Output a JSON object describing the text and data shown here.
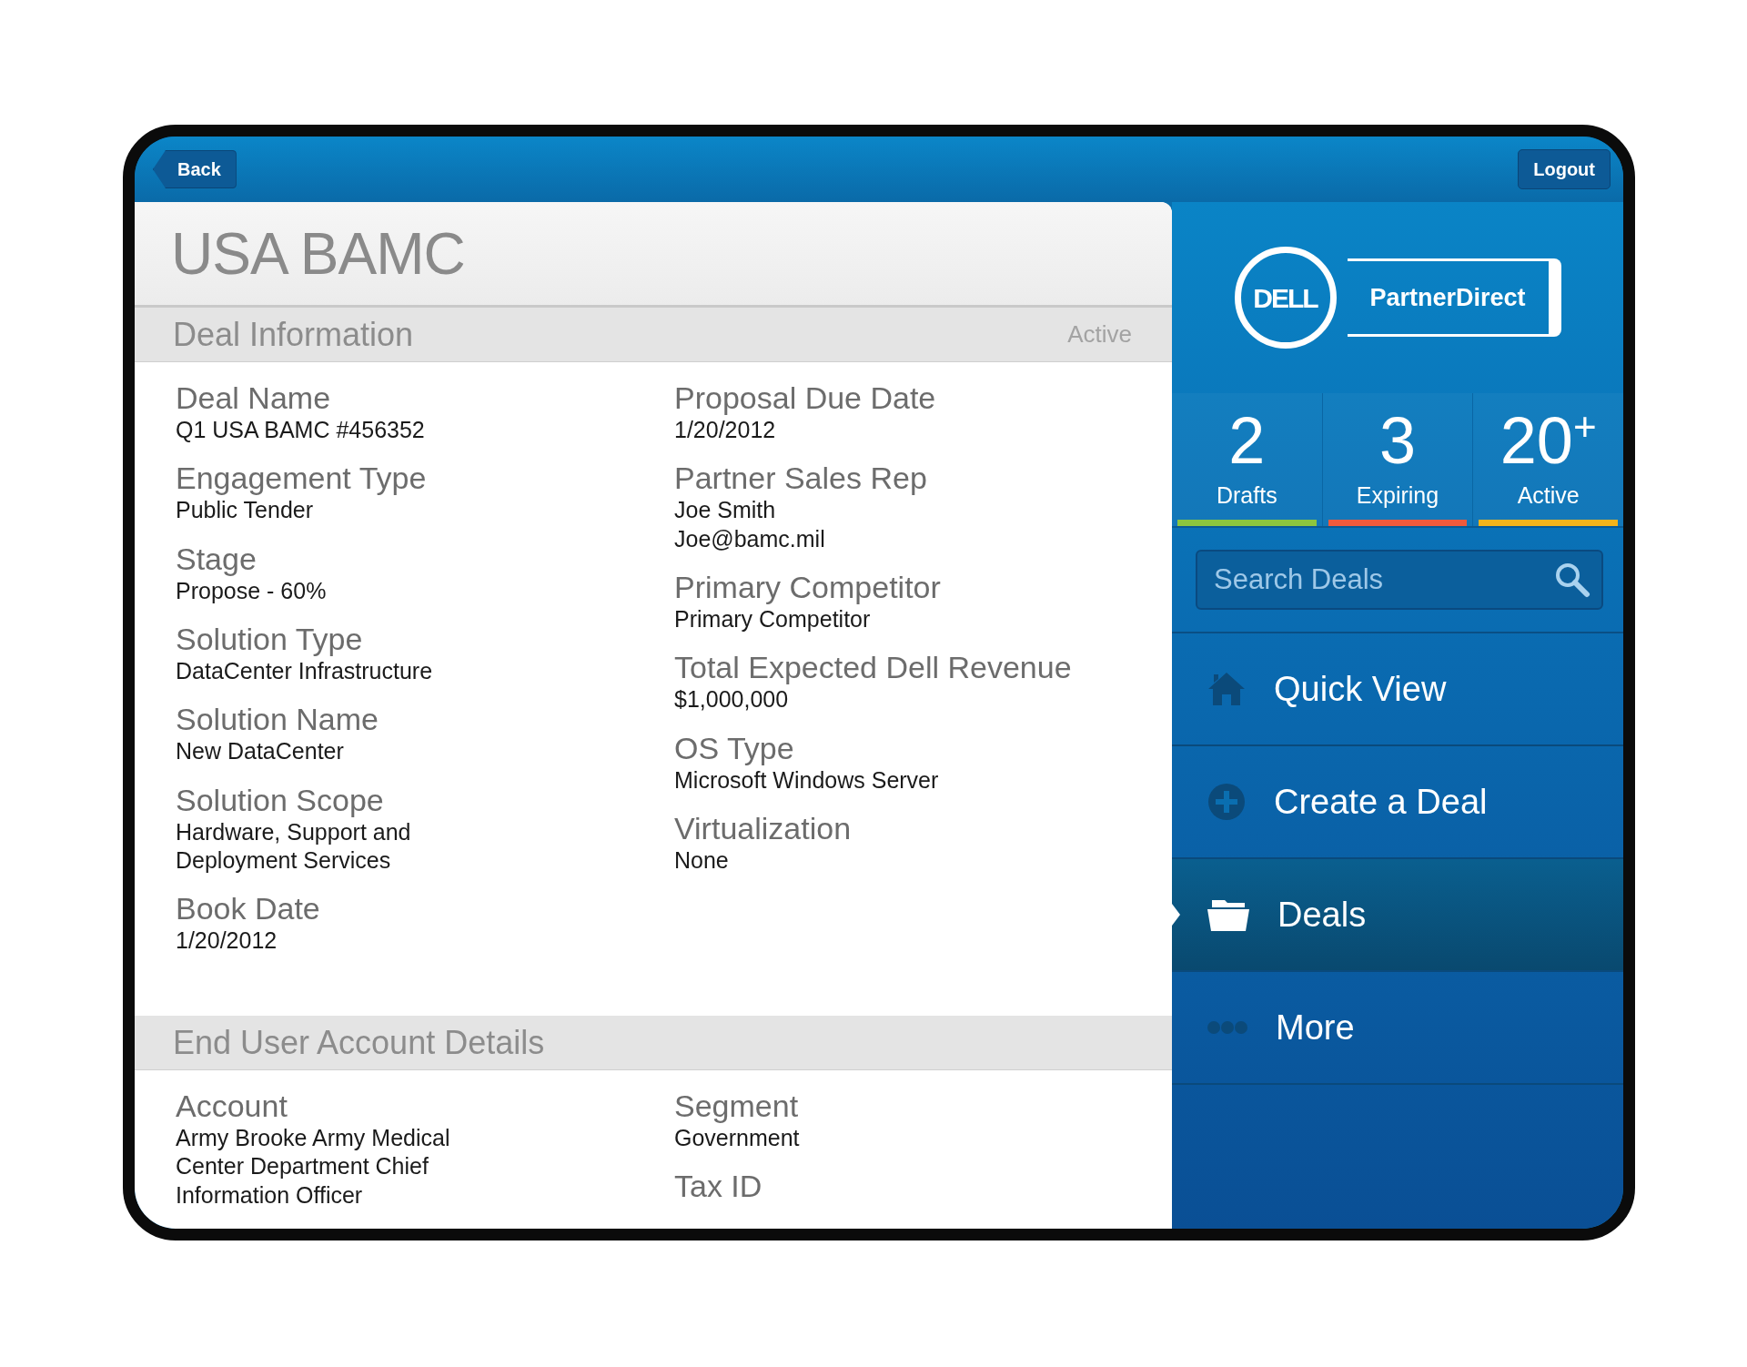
{
  "top_bar": {
    "back_button": "Back",
    "logout_button": "Logout"
  },
  "deal": {
    "title": "USA BAMC",
    "sections": [
      {
        "heading": "Deal Information",
        "status": "Active",
        "columns": [
          [
            {
              "label": "Deal Name",
              "values": [
                "Q1 USA BAMC #456352"
              ]
            },
            {
              "label": "Engagement Type",
              "values": [
                "Public Tender"
              ]
            },
            {
              "label": "Stage",
              "values": [
                "Propose - 60%"
              ]
            },
            {
              "label": "Solution Type",
              "values": [
                "DataCenter Infrastructure"
              ]
            },
            {
              "label": "Solution Name",
              "values": [
                "New DataCenter"
              ]
            },
            {
              "label": "Solution Scope",
              "values": [
                "Hardware, Support and Deployment Services"
              ]
            },
            {
              "label": "Book Date",
              "values": [
                "1/20/2012"
              ]
            }
          ],
          [
            {
              "label": "Proposal Due Date",
              "values": [
                "1/20/2012"
              ]
            },
            {
              "label": "Partner Sales Rep",
              "values": [
                "Joe Smith",
                "Joe@bamc.mil"
              ]
            },
            {
              "label": "Primary Competitor",
              "values": [
                "Primary Competitor"
              ]
            },
            {
              "label": "Total Expected Dell Revenue",
              "values": [
                "$1,000,000"
              ]
            },
            {
              "label": "OS Type",
              "values": [
                "Microsoft Windows Server"
              ]
            },
            {
              "label": "Virtualization",
              "values": [
                "None"
              ]
            }
          ]
        ]
      },
      {
        "heading": "End User Account Details",
        "columns": [
          [
            {
              "label": "Account",
              "values": [
                "Army Brooke Army Medical Center Department Chief Information Officer"
              ]
            }
          ],
          [
            {
              "label": "Segment",
              "values": [
                "Government"
              ]
            },
            {
              "label": "Tax ID"
            }
          ]
        ]
      }
    ]
  },
  "sidebar": {
    "logo": {
      "mark": "DELL",
      "name": "PartnerDirect"
    },
    "stats": [
      {
        "count": "2",
        "label": "Drafts",
        "color": "#8cc63e"
      },
      {
        "count": "3",
        "label": "Expiring",
        "color": "#f05a3c"
      },
      {
        "count": "20",
        "suffix": "+",
        "label": "Active",
        "color": "#f5b41a"
      }
    ],
    "search": {
      "placeholder": "Search Deals"
    },
    "menu": [
      {
        "label": "Quick View",
        "selected": false
      },
      {
        "label": "Create a Deal",
        "selected": false
      },
      {
        "label": "Deals",
        "selected": true
      },
      {
        "label": "More",
        "selected": false
      }
    ]
  }
}
